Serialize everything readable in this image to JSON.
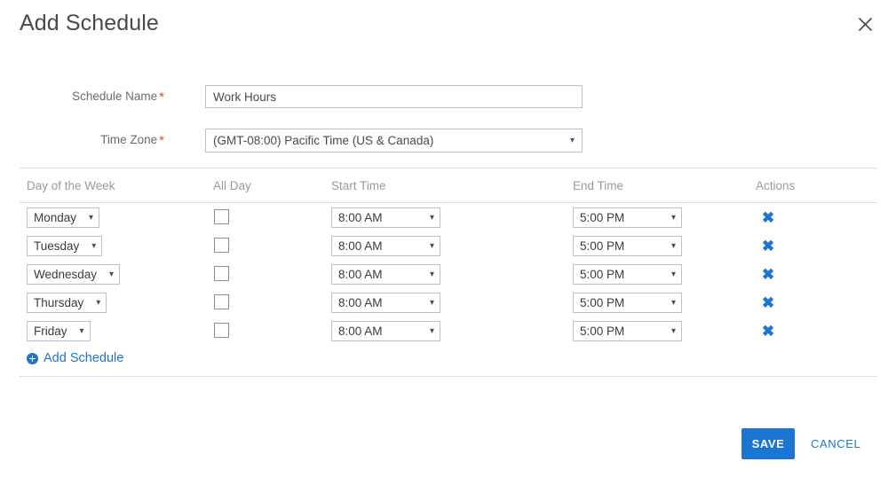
{
  "dialog": {
    "title": "Add Schedule",
    "close_icon": "close-icon"
  },
  "form": {
    "schedule_name": {
      "label": "Schedule Name",
      "required_mark": "*",
      "value": "Work Hours",
      "placeholder": ""
    },
    "time_zone": {
      "label": "Time Zone",
      "required_mark": "*",
      "value": "(GMT-08:00) Pacific Time (US & Canada)",
      "caret_icon": "chevron-down-icon"
    }
  },
  "table": {
    "headers": {
      "day": "Day of the Week",
      "all_day": "All Day",
      "start_time": "Start Time",
      "end_time": "End Time",
      "actions": "Actions"
    },
    "rows": [
      {
        "day": "Monday",
        "all_day": false,
        "start_time": "8:00 AM",
        "end_time": "5:00 PM",
        "delete_icon": "✖"
      },
      {
        "day": "Tuesday",
        "all_day": false,
        "start_time": "8:00 AM",
        "end_time": "5:00 PM",
        "delete_icon": "✖"
      },
      {
        "day": "Wednesday",
        "all_day": false,
        "start_time": "8:00 AM",
        "end_time": "5:00 PM",
        "delete_icon": "✖"
      },
      {
        "day": "Thursday",
        "all_day": false,
        "start_time": "8:00 AM",
        "end_time": "5:00 PM",
        "delete_icon": "✖"
      },
      {
        "day": "Friday",
        "all_day": false,
        "start_time": "8:00 AM",
        "end_time": "5:00 PM",
        "delete_icon": "✖"
      }
    ],
    "caret_icon": "chevron-down-icon"
  },
  "add_schedule_link": {
    "label": "Add Schedule",
    "icon": "plus-circle-icon"
  },
  "footer": {
    "save_label": "SAVE",
    "cancel_label": "CANCEL"
  },
  "colors": {
    "accent": "#1b76d2",
    "required": "#e8491d",
    "border": "#b9c2cc",
    "rule": "#dddddd",
    "label_text": "#6b6b6b",
    "header_text": "#9a9a9a"
  }
}
